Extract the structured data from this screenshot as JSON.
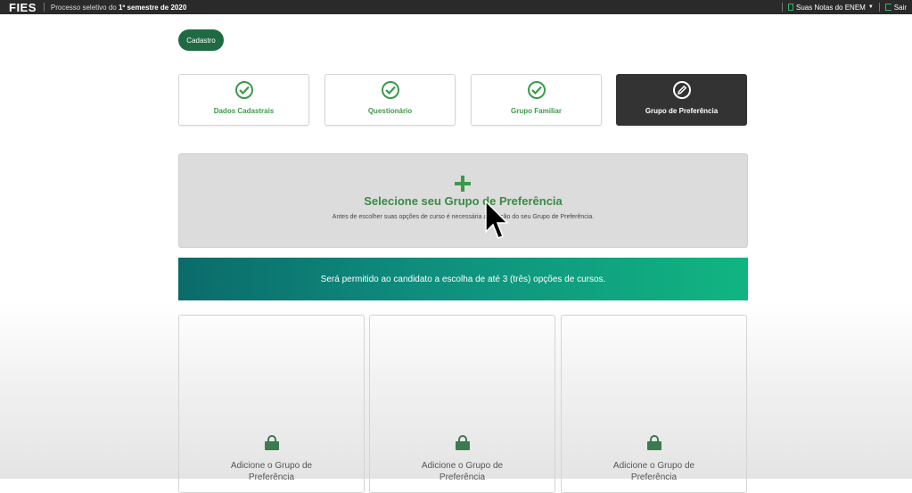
{
  "topbar": {
    "logo": "FIES",
    "subtitle_prefix": "Processo seletivo do ",
    "subtitle_bold": "1º semestre de 2020",
    "notas_label": "Suas Notas do ENEM",
    "sair_label": "Sair"
  },
  "cadastro_label": "Cadastro",
  "steps": [
    {
      "label": "Dados Cadastrais",
      "status": "completed"
    },
    {
      "label": "Questionário",
      "status": "completed"
    },
    {
      "label": "Grupo Familiar",
      "status": "completed"
    },
    {
      "label": "Grupo de Preferência",
      "status": "active"
    }
  ],
  "select_group": {
    "title": "Selecione seu Grupo de Preferência",
    "description": "Antes de escolher suas opções de curso é necessária a seleção do seu Grupo de Preferência."
  },
  "banner_text": "Será permitido ao candidato a escolha de até 3 (três) opções de cursos.",
  "option_cards": [
    {
      "label": "Adicione o Grupo de Preferência"
    },
    {
      "label": "Adicione o Grupo de Preferência"
    },
    {
      "label": "Adicione o Grupo de Preferência"
    }
  ],
  "colors": {
    "topbar": "#2a2a2a",
    "accent_green": "#3a9a4a",
    "active_step": "#333333",
    "banner_start": "#0b6b6a",
    "banner_end": "#11b581"
  }
}
